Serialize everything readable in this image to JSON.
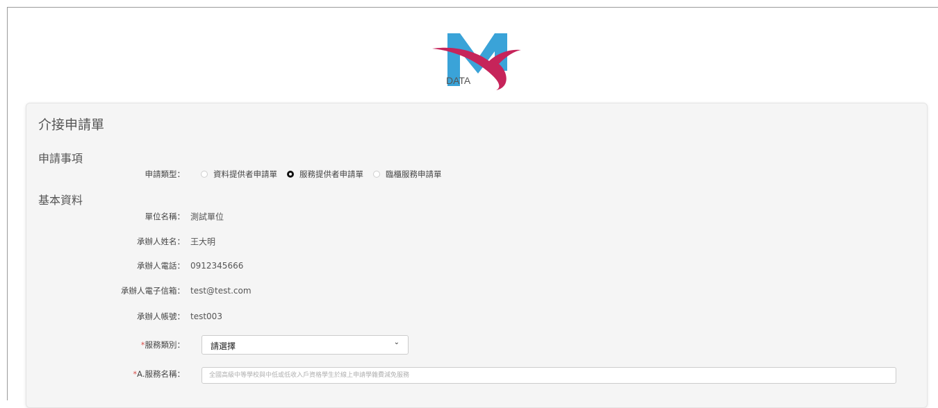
{
  "logo": {
    "text": "DATA",
    "letter": "M",
    "colors": {
      "blue": "#3aa3d8",
      "magenta": "#c6245a"
    }
  },
  "form": {
    "title": "介接申請單",
    "sections": {
      "application": "申請事項",
      "basic": "基本資料"
    },
    "application_type": {
      "label": "申請類型：",
      "options": [
        "資料提供者申請單",
        "服務提供者申請單",
        "臨櫃服務申請單"
      ],
      "selected": "服務提供者申請單"
    },
    "fields": [
      {
        "label": "單位名稱：",
        "value": "測試單位"
      },
      {
        "label": "承辦人姓名：",
        "value": "王大明"
      },
      {
        "label": "承辦人電話：",
        "value": "0912345666"
      },
      {
        "label": "承辦人電子信箱：",
        "value": "test@test.com"
      },
      {
        "label": "承辦人帳號：",
        "value": "test003"
      }
    ],
    "service_category": {
      "required_mark": "*",
      "label": "服務類別：",
      "selected": "請選擇"
    },
    "service_name": {
      "required_mark": "*",
      "label": "A.服務名稱：",
      "placeholder": "全國高級中等學校與中低或低收入戶資格學生於線上申請學雜費減免服務"
    }
  }
}
